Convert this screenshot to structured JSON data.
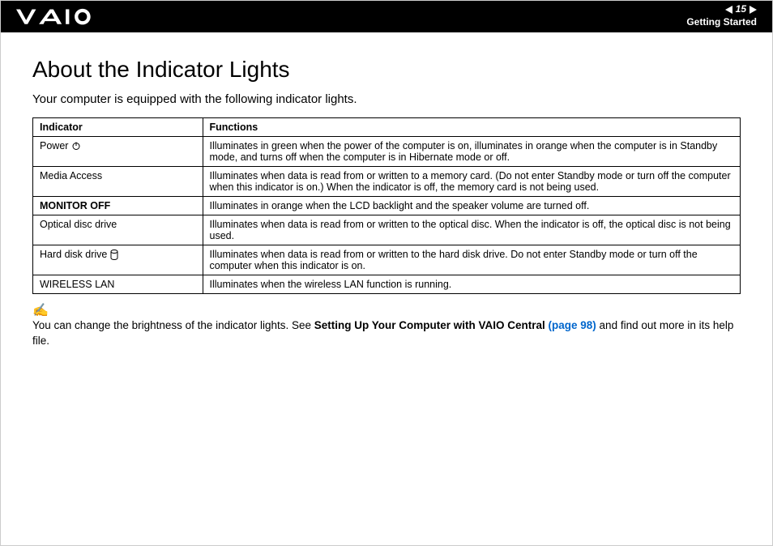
{
  "header": {
    "page_number": "15",
    "section": "Getting Started"
  },
  "page": {
    "title": "About the Indicator Lights",
    "intro": "Your computer is equipped with the following indicator lights."
  },
  "table": {
    "headers": {
      "indicator": "Indicator",
      "functions": "Functions"
    },
    "rows": [
      {
        "indicator": "Power",
        "icon": "power",
        "bold": false,
        "functions": "Illuminates in green when the power of the computer is on, illuminates in orange when the computer is in Standby mode, and turns off when the computer is in Hibernate mode or off."
      },
      {
        "indicator": "Media Access",
        "icon": "",
        "bold": false,
        "functions": "Illuminates when data is read from or written to a memory card. (Do not enter Standby mode or turn off the computer when this indicator is on.) When the indicator is off, the memory card is not being used."
      },
      {
        "indicator": "MONITOR OFF",
        "icon": "",
        "bold": true,
        "functions": "Illuminates in orange when the LCD backlight and the speaker volume are turned off."
      },
      {
        "indicator": "Optical disc drive",
        "icon": "",
        "bold": false,
        "functions": "Illuminates when data is read from or written to the optical disc. When the indicator is off, the optical disc is not being used."
      },
      {
        "indicator": "Hard disk drive",
        "icon": "hdd",
        "bold": false,
        "functions": "Illuminates when data is read from or written to the hard disk drive. Do not enter Standby mode or turn off the computer when this indicator is on."
      },
      {
        "indicator": "WIRELESS LAN",
        "icon": "",
        "bold": false,
        "functions": "Illuminates when the wireless LAN function is running."
      }
    ]
  },
  "note": {
    "prefix": "You can change the brightness of the indicator lights. See ",
    "bold": "Setting Up Your Computer with VAIO Central ",
    "link": "(page 98)",
    "suffix": " and find out more in its help file."
  }
}
